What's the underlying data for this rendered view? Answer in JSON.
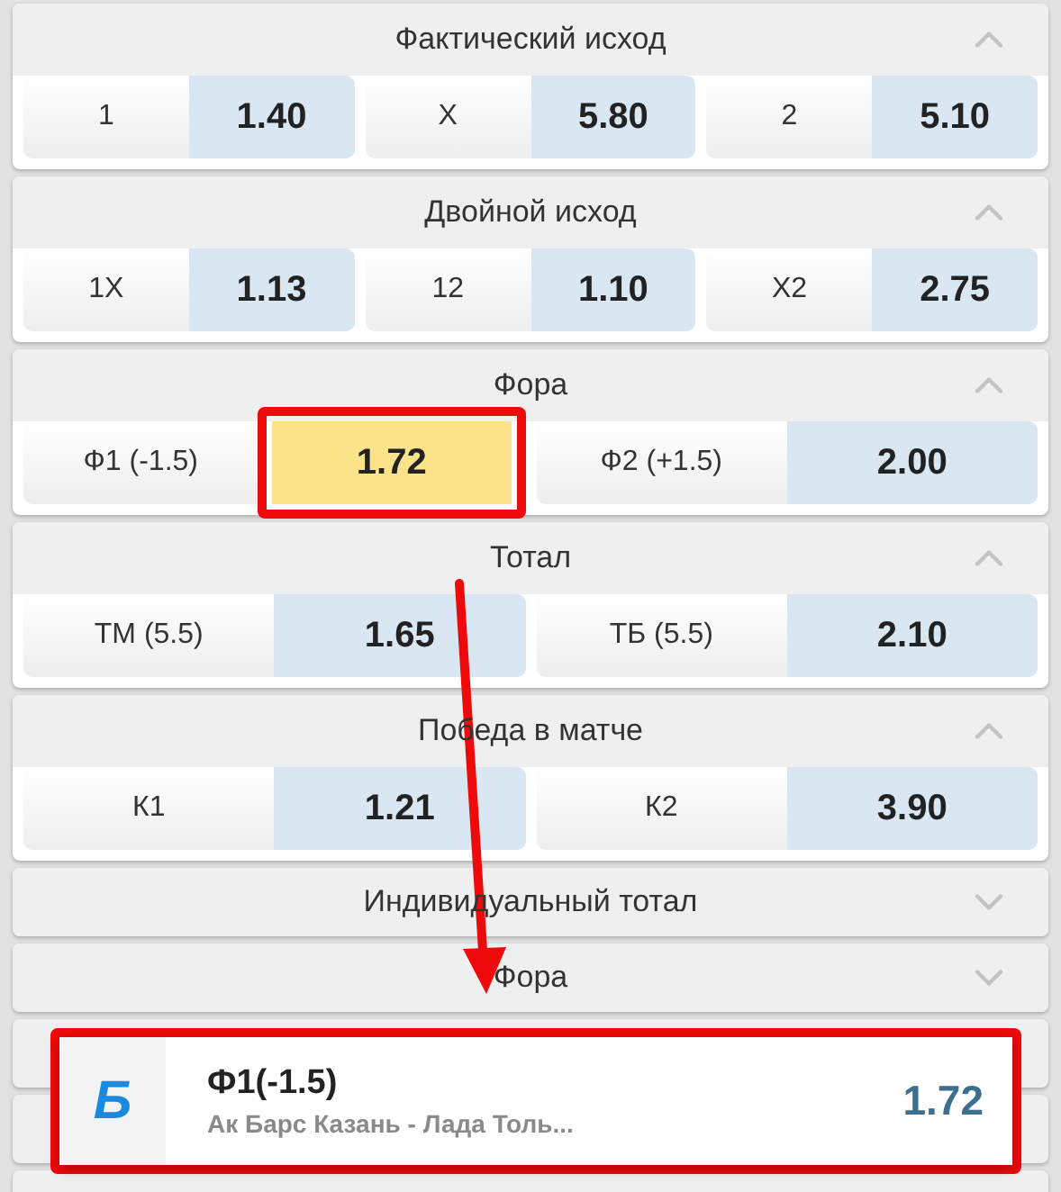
{
  "markets": [
    {
      "title": "Фактический исход",
      "expanded": true,
      "outcomes": [
        {
          "label": "1",
          "odds": "1.40",
          "selected": false,
          "annotated": false
        },
        {
          "label": "X",
          "odds": "5.80",
          "selected": false,
          "annotated": false
        },
        {
          "label": "2",
          "odds": "5.10",
          "selected": false,
          "annotated": false
        }
      ]
    },
    {
      "title": "Двойной исход",
      "expanded": true,
      "outcomes": [
        {
          "label": "1X",
          "odds": "1.13",
          "selected": false,
          "annotated": false
        },
        {
          "label": "12",
          "odds": "1.10",
          "selected": false,
          "annotated": false
        },
        {
          "label": "X2",
          "odds": "2.75",
          "selected": false,
          "annotated": false
        }
      ]
    },
    {
      "title": "Фора",
      "expanded": true,
      "outcomes": [
        {
          "label": "Ф1 (-1.5)",
          "odds": "1.72",
          "selected": true,
          "annotated": true
        },
        {
          "label": "Ф2 (+1.5)",
          "odds": "2.00",
          "selected": false,
          "annotated": false
        }
      ]
    },
    {
      "title": "Тотал",
      "expanded": true,
      "outcomes": [
        {
          "label": "ТМ (5.5)",
          "odds": "1.65",
          "selected": false,
          "annotated": false
        },
        {
          "label": "ТБ (5.5)",
          "odds": "2.10",
          "selected": false,
          "annotated": false
        }
      ]
    },
    {
      "title": "Победа в матче",
      "expanded": true,
      "outcomes": [
        {
          "label": "К1",
          "odds": "1.21",
          "selected": false,
          "annotated": false
        },
        {
          "label": "К2",
          "odds": "3.90",
          "selected": false,
          "annotated": false
        }
      ]
    },
    {
      "title": "Индивидуальный тотал",
      "expanded": false
    },
    {
      "title": "Фора",
      "expanded": false
    }
  ],
  "bet_toast": {
    "logo": "Б",
    "bet": "Ф1(-1.5)",
    "match": "Ак Барс Казань - Лада Толь...",
    "odds": "1.72",
    "annotated": true
  }
}
